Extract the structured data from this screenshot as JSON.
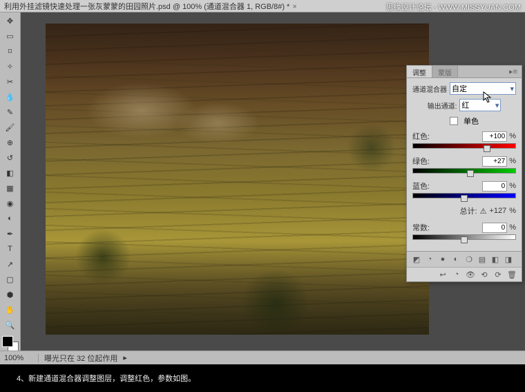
{
  "watermark": "思缘设计论坛 - WWW.MISSYUAN.COM",
  "titlebar": {
    "text": "利用外挂滤镜快速处理一张灰蒙蒙的田园照片.psd @ 100% (通道混合器 1, RGB/8#) *"
  },
  "panel": {
    "tabs": {
      "active": "调整",
      "inactive": "蒙版"
    },
    "preset_label": "通道混合器",
    "preset_value": "自定",
    "output_label": "输出通道:",
    "output_value": "红",
    "mono_label": "单色",
    "sliders": {
      "red": {
        "label": "红色:",
        "value": "+100",
        "unit": "%",
        "pos": 72
      },
      "green": {
        "label": "绿色:",
        "value": "+27",
        "unit": "%",
        "pos": 56
      },
      "blue": {
        "label": "蓝色:",
        "value": "0",
        "unit": "%",
        "pos": 50
      }
    },
    "total": {
      "label": "总计:",
      "icon": "⚠",
      "value": "+127",
      "unit": "%"
    },
    "constant": {
      "label": "常数:",
      "value": "0",
      "unit": "%",
      "pos": 50
    }
  },
  "statusbar": {
    "zoom": "100%",
    "info": "曝光只在 32 位起作用"
  },
  "caption": "4、新建通道混合器调整图层，调整红色，参数如图。",
  "chart_data": {
    "type": "table",
    "title": "Channel Mixer — Output: Red",
    "series": [
      {
        "name": "红色",
        "value": 100,
        "unit": "%"
      },
      {
        "name": "绿色",
        "value": 27,
        "unit": "%"
      },
      {
        "name": "蓝色",
        "value": 0,
        "unit": "%"
      },
      {
        "name": "常数",
        "value": 0,
        "unit": "%"
      }
    ],
    "total": 127
  }
}
